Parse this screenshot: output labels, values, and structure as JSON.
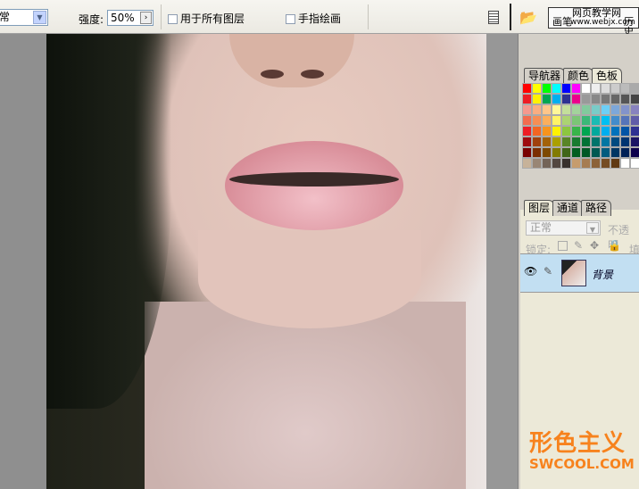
{
  "toolbar": {
    "mode_value": "常",
    "strength_label": "强度:",
    "strength_value": "50%",
    "all_layers_label": "用于所有图层",
    "finger_painting_label": "手指绘画",
    "watermark_top": "网页教学网",
    "watermark_url": "www.webjx.com",
    "brushes_tab": "画笔",
    "history_tab": "历史"
  },
  "panel_top": {
    "tabs": [
      "导航器",
      "颜色",
      "色板"
    ],
    "active": 2
  },
  "swatches": [
    "#f00",
    "#ff0",
    "#0f0",
    "#0ff",
    "#00f",
    "#f0f",
    "#fff",
    "#eee",
    "#ddd",
    "#ccc",
    "#bbb",
    "#aaa",
    "#ed1c24",
    "#fff200",
    "#00a651",
    "#00aeef",
    "#2e3192",
    "#ec008c",
    "#999",
    "#888",
    "#777",
    "#666",
    "#555",
    "#444",
    "#f5998e",
    "#f9ad81",
    "#fdc68a",
    "#fff799",
    "#c4df9b",
    "#a3d39c",
    "#82ca9d",
    "#7accc8",
    "#6dcff6",
    "#7da7d9",
    "#8393ca",
    "#8882be",
    "#f26c4f",
    "#f68e55",
    "#fbaf5c",
    "#fff467",
    "#acd372",
    "#7cc576",
    "#3bb878",
    "#1abbb4",
    "#00bff3",
    "#438ccb",
    "#5574b9",
    "#605ca8",
    "#ed1c24",
    "#f26522",
    "#f7941d",
    "#fff200",
    "#8dc63f",
    "#39b54a",
    "#00a651",
    "#00a99d",
    "#00aeef",
    "#0072bc",
    "#0054a6",
    "#2e3192",
    "#9e0b0f",
    "#a0410d",
    "#a36209",
    "#aba000",
    "#598527",
    "#197b30",
    "#007236",
    "#00746b",
    "#0076a3",
    "#004a80",
    "#003471",
    "#1b1464",
    "#790000",
    "#7b2e00",
    "#7d4900",
    "#827b00",
    "#406618",
    "#005e20",
    "#005826",
    "#005952",
    "#005b7f",
    "#003663",
    "#002157",
    "#0d004c",
    "#c7b299",
    "#998675",
    "#736357",
    "#534741",
    "#37302d",
    "#c69c6d",
    "#a67c52",
    "#8c6239",
    "#754c24",
    "#603913",
    "#fff",
    "#fff"
  ],
  "layers": {
    "tabs": [
      "图层",
      "通道",
      "路径"
    ],
    "active": 0,
    "blend_mode": "正常",
    "opacity_label": "不透明",
    "lock_label": "锁定:",
    "fill_label": "填",
    "layer_name": "背景"
  },
  "logo": {
    "cn": "形色主义",
    "en": "SWCOOL.COM"
  }
}
